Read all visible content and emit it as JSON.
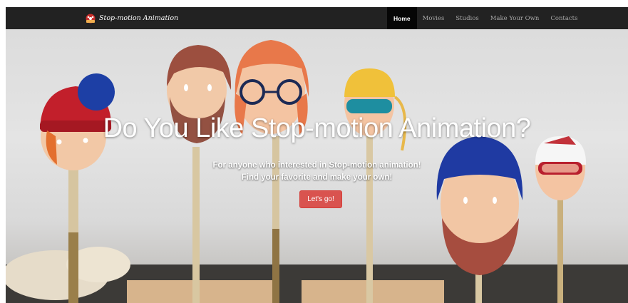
{
  "navbar": {
    "brand": "Stop-motion Animation",
    "brand_icon": "film-reel-logo-icon",
    "links": [
      {
        "label": "Home",
        "active": true
      },
      {
        "label": "Movies",
        "active": false
      },
      {
        "label": "Studios",
        "active": false
      },
      {
        "label": "Make Your Own",
        "active": false
      },
      {
        "label": "Contacts",
        "active": false
      }
    ]
  },
  "hero": {
    "title": "Do You Like Stop-motion Animation?",
    "subtitle_line1": "For anyone who interested in Stop-motion animation!",
    "subtitle_line2": "Find your favorite and make your own!",
    "cta_label": "Let's go!"
  },
  "colors": {
    "navbar_bg": "#222222",
    "cta_bg": "#d9534f"
  }
}
